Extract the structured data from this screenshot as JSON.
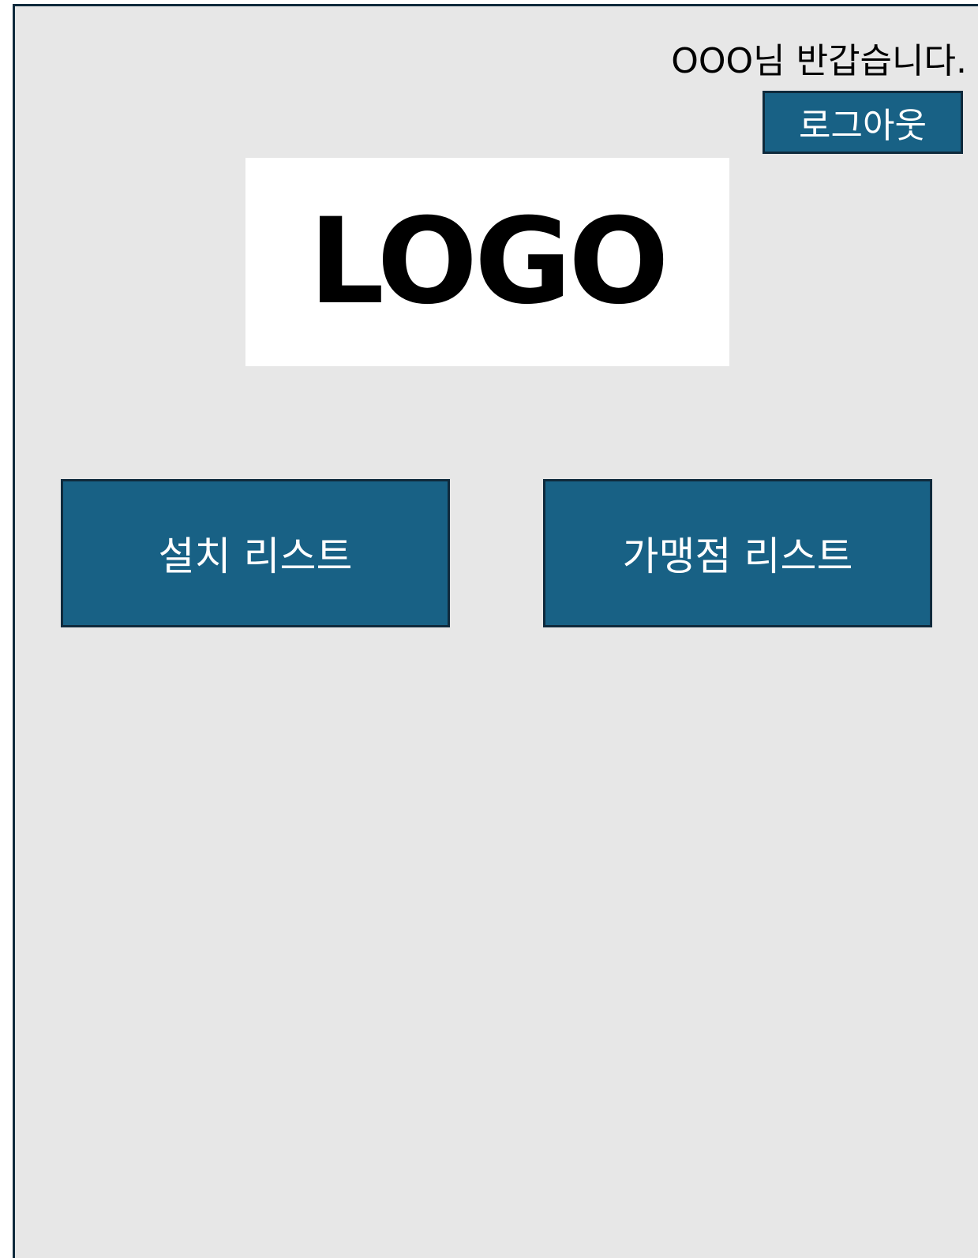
{
  "header": {
    "greeting": "OOO님 반갑습니다.",
    "logout_label": "로그아웃"
  },
  "logo": {
    "text": "LOGO"
  },
  "menu": {
    "install_list_label": "설치 리스트",
    "store_list_label": "가맹점 리스트"
  },
  "colors": {
    "background": "#e7e7e7",
    "button": "#186185",
    "border": "#0f2a3c"
  }
}
